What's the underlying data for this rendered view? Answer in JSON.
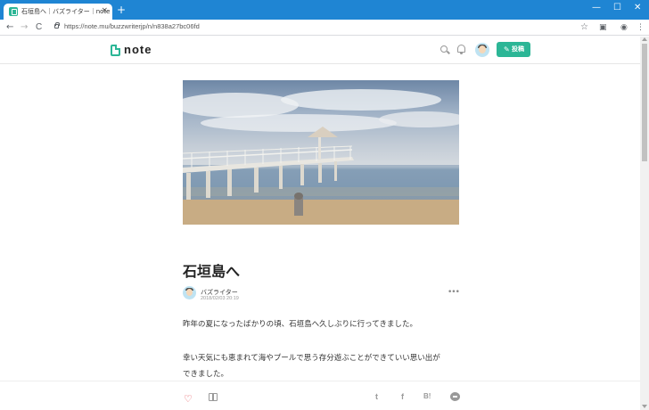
{
  "browser": {
    "tab_title": "石垣島へ｜バズライター｜note",
    "tab_close": "×",
    "new_tab": "+",
    "minimize": "—",
    "maximize": "☐",
    "close": "✕",
    "url": "https://note.mu/buzzwriterjp/n/n838a27bc06fd",
    "back": "←",
    "forward": "→",
    "reload": "C",
    "star": "☆",
    "menu": "⋮"
  },
  "header": {
    "logo_text": "note",
    "post_button_label": "投稿",
    "pencil": "✎"
  },
  "article": {
    "title": "石垣島へ",
    "author": "バズライター",
    "date": "2018/02/03 20:19",
    "more": "•••",
    "paragraphs": [
      "昨年の夏になったばかりの頃、石垣島へ久しぶりに行ってきました。",
      "幸い天気にも恵まれて海やプールで思う存分遊ぶことができていい思い出が",
      "できました。"
    ]
  },
  "actions": {
    "heart": "♡",
    "twitter": "t",
    "facebook": "f",
    "hatena": "B!"
  },
  "icons": {
    "search": "search-icon",
    "notifications": "bell-icon",
    "like": "heart-icon",
    "magazine": "magazine-icon",
    "line": "line-icon"
  },
  "colors": {
    "accent": "#2cb696",
    "browser_frame": "#1f85d3",
    "like": "#e5535b"
  }
}
